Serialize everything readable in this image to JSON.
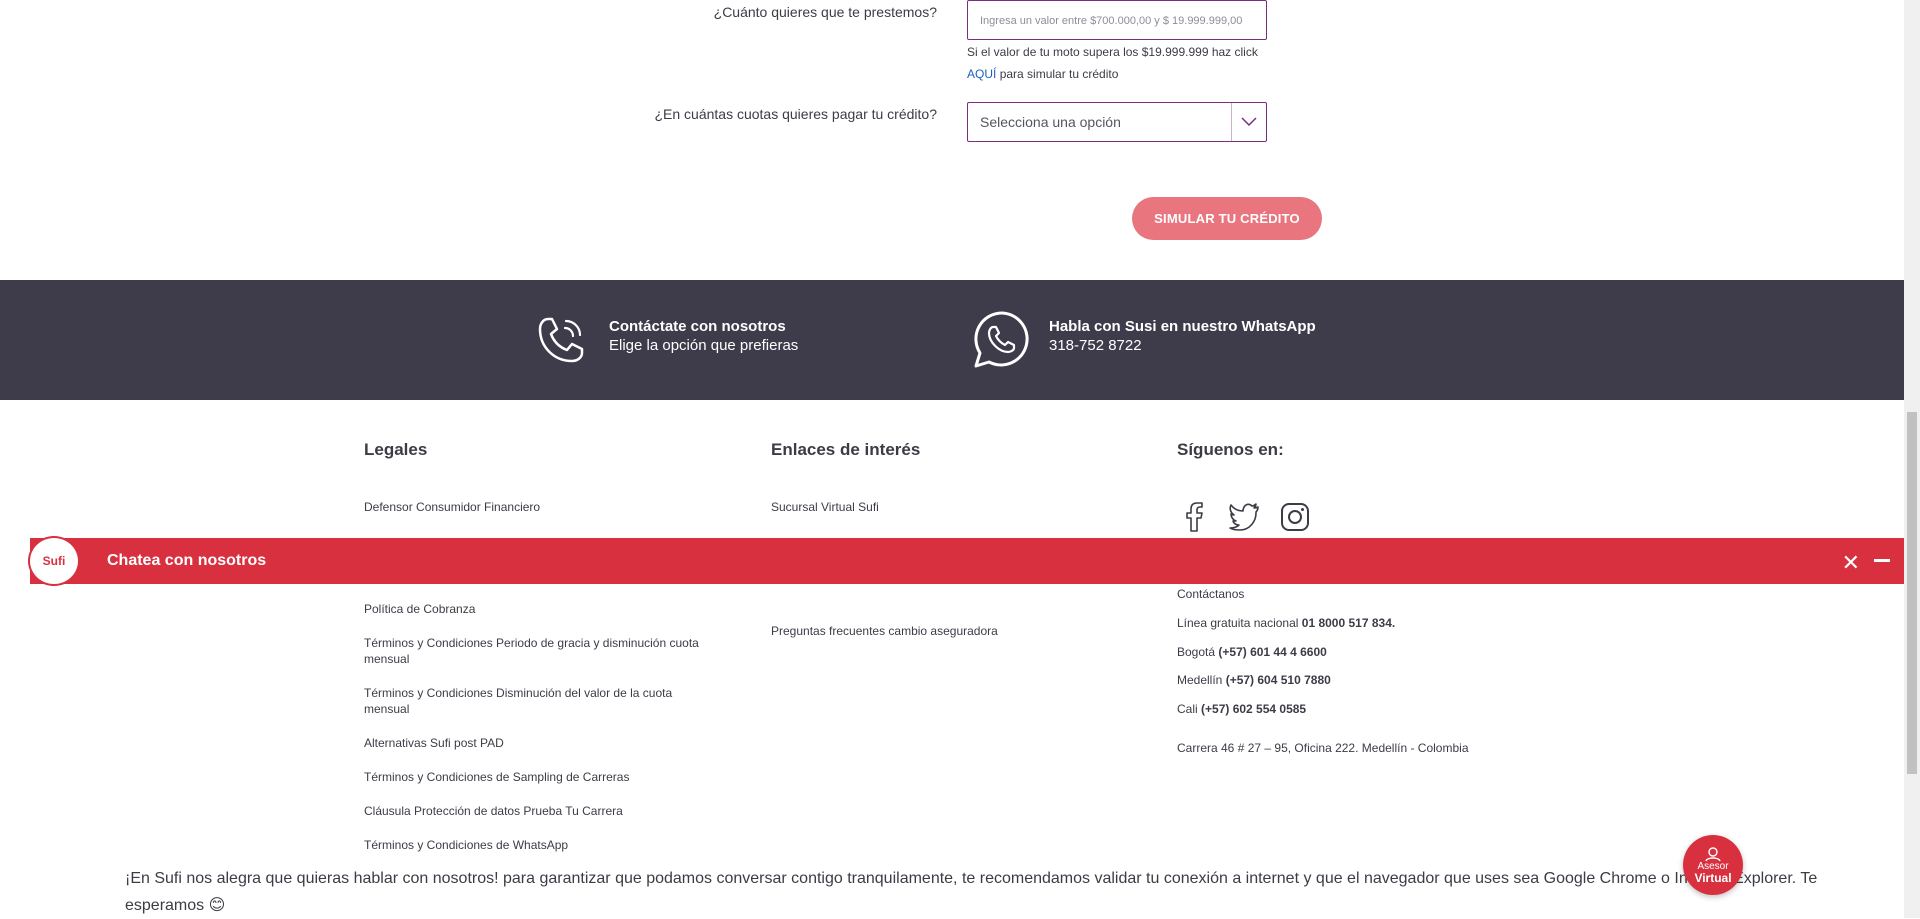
{
  "form": {
    "amount_label": "¿Cuánto quieres que te prestemos?",
    "amount_placeholder": "Ingresa un valor entre $700.000,00 y $ 19.999.999,00",
    "amount_hint": "Si el valor de tu moto supera los $19.999.999 haz click",
    "amount_hint_link": "AQUÍ",
    "amount_hint_after": "para simular tu crédito",
    "installments_label": "¿En cuántas cuotas quieres pagar tu crédito?",
    "installments_selected": "Selecciona una opción",
    "simulate_button": "SIMULAR TU CRÉDITO"
  },
  "contact_band": {
    "contact_title": "Contáctate con nosotros",
    "contact_sub": "Elige la opción que prefieras",
    "whatsapp_title": "Habla con Susi en nuestro WhatsApp",
    "whatsapp_number": "318-752 8722"
  },
  "footer": {
    "legales": {
      "title": "Legales",
      "links": [
        "Defensor Consumidor Financiero",
        "Política de Cobranza",
        "Términos y Condiciones Periodo de gracia y disminución cuota mensual",
        "Términos y Condiciones Disminución del valor de la cuota mensual",
        "Alternativas Sufi post PAD",
        "Términos y Condiciones de Sampling de Carreras",
        "Cláusula Protección de datos Prueba Tu Carrera",
        "Términos y Condiciones de WhatsApp"
      ]
    },
    "enlaces": {
      "title": "Enlaces de interés",
      "links": [
        "Sucursal Virtual Sufi",
        "Preguntas frecuentes cambio aseguradora"
      ]
    },
    "siguenos": {
      "title": "Síguenos en:",
      "social": [
        "facebook-icon",
        "twitter-icon",
        "instagram-icon"
      ],
      "contact_title": "Contáctanos",
      "line1_label": "Línea gratuita nacional",
      "line1_value": "01 8000 517 834.",
      "line2_label": "Bogotá",
      "line2_value": "(+57) 601 44 4 6600",
      "line3_label": "Medellín",
      "line3_value": "(+57) 604 510 7880",
      "line4_label": "Cali",
      "line4_value": "(+57) 602 554 0585",
      "address": "Carrera 46 # 27 – 95, Oficina 222. Medellín - Colombia"
    }
  },
  "chat": {
    "logo_text": "Sufi",
    "title": "Chatea con nosotros",
    "message": "¡En Sufi nos alegra que quieras hablar con nosotros! para garantizar que podamos conversar contigo tranquilamente, te recomendamos validar tu conexión a internet y que el navegador que uses sea Google Chrome o Internet Explorer. Te esperamos 😊",
    "asesor_line1": "Asesor",
    "asesor_line2": "Virtual"
  },
  "colors": {
    "accent_purple": "#7b2c83",
    "button_pink": "#e9767f",
    "band_dark": "#3e3b4b",
    "chat_red": "#d9303f"
  }
}
